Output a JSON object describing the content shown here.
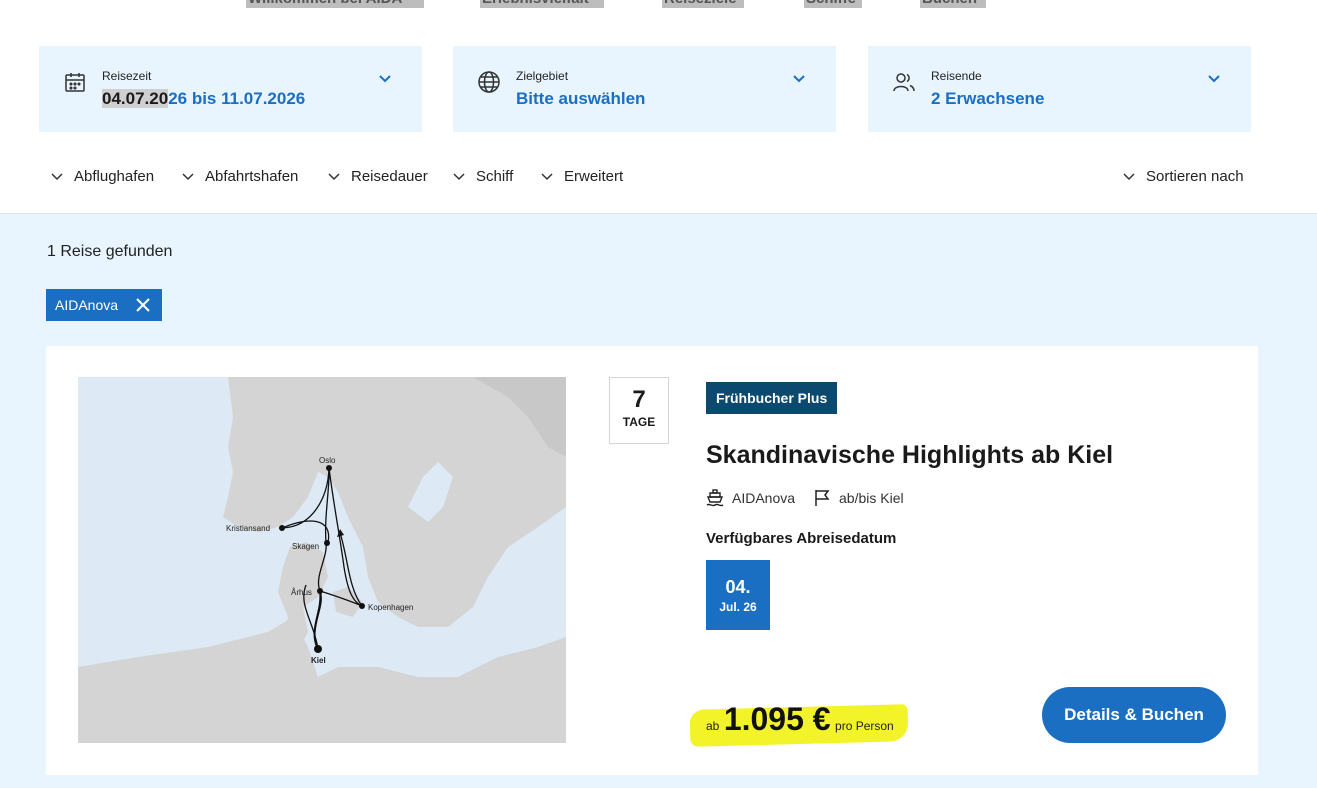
{
  "topnav": [
    "Willkommen bei AIDA",
    "Erlebnisvielfalt",
    "Reiseziele",
    "Schiffe",
    "Buchen"
  ],
  "search": {
    "reisezeit": {
      "label": "Reisezeit",
      "value_hl": "04.07.20",
      "value_rest": "26 bis 11.07.2026",
      "icon": "calendar-icon"
    },
    "zielgebiet": {
      "label": "Zielgebiet",
      "value": "Bitte auswählen",
      "icon": "globe-icon"
    },
    "reisende": {
      "label": "Reisende",
      "value": "2 Erwachsene",
      "icon": "people-icon"
    }
  },
  "filters": [
    "Abflughafen",
    "Abfahrtshafen",
    "Reisedauer",
    "Schiff",
    "Erweitert"
  ],
  "sort_label": "Sortieren nach",
  "results": {
    "count_text": "1 Reise gefunden",
    "active_filter": "AIDAnova"
  },
  "cruise": {
    "days": "7",
    "days_unit": "TAGE",
    "badge": "Frühbucher Plus",
    "title": "Skandinavische Highlights ab Kiel",
    "ship": "AIDAnova",
    "port": "ab/bis Kiel",
    "available_label": "Verfügbares Abreisedatum",
    "date_day": "04.",
    "date_month": "Jul. 26",
    "price_prefix": "ab",
    "price": "1.095 €",
    "price_suffix": "pro Person",
    "cta": "Details & Buchen",
    "map_labels": {
      "oslo": "Oslo",
      "kristiansand": "Kristiansand",
      "skagen": "Skagen",
      "arhus": "Århus",
      "kopenhagen": "Kopenhagen",
      "kiel": "Kiel"
    }
  },
  "colors": {
    "accent": "#1b6fc2",
    "panel": "#e8f4fe",
    "badge": "#0b4a6e",
    "highlight": "#f3f32a"
  }
}
